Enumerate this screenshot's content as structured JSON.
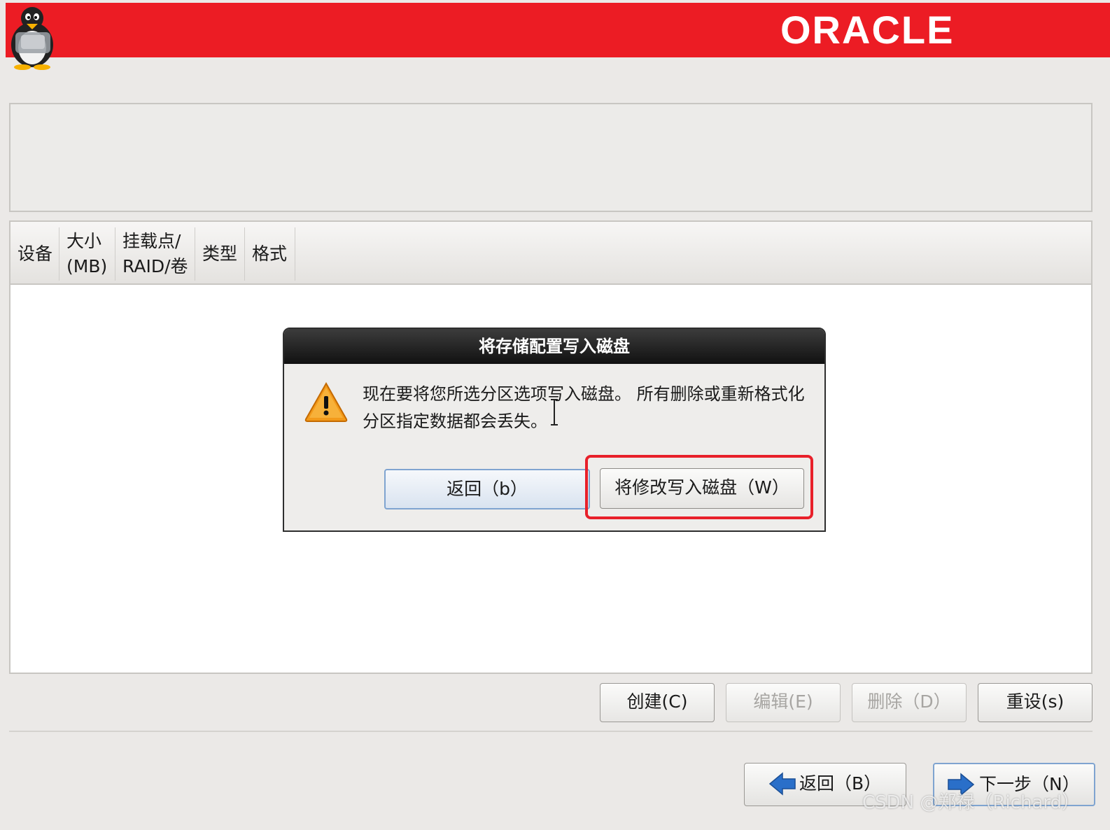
{
  "header": {
    "brand": "ORACLE"
  },
  "table": {
    "columns": [
      {
        "label": "设备"
      },
      {
        "label": "大小\n(MB)"
      },
      {
        "label": "挂载点/\nRAID/卷"
      },
      {
        "label": "类型"
      },
      {
        "label": "格式"
      }
    ]
  },
  "dialog": {
    "title": "将存储配置写入磁盘",
    "message": "现在要将您所选分区选项写入磁盘。 所有删除或重新格式化分区指定数据都会丢失。",
    "back_button": {
      "label": "返回（b）",
      "shortcut": "b"
    },
    "write_button": {
      "label": "将修改写入磁盘（W）",
      "shortcut": "W"
    }
  },
  "actions": {
    "create": {
      "label": "创建(C)",
      "enabled": true
    },
    "edit": {
      "label": "编辑(E)",
      "enabled": false
    },
    "delete": {
      "label": "删除（D）",
      "enabled": false
    },
    "reset": {
      "label": "重设(s)",
      "enabled": true
    }
  },
  "navigation": {
    "back": {
      "label": "返回（B）"
    },
    "next": {
      "label": "下一步（N）"
    }
  },
  "watermark": "CSDN @郑禄（Richard）",
  "colors": {
    "banner_red": "#ec1c24",
    "dialog_title_bg": "#1e1e1e",
    "highlight_red": "#e8202a",
    "nav_arrow_blue": "#2a6fc9"
  }
}
